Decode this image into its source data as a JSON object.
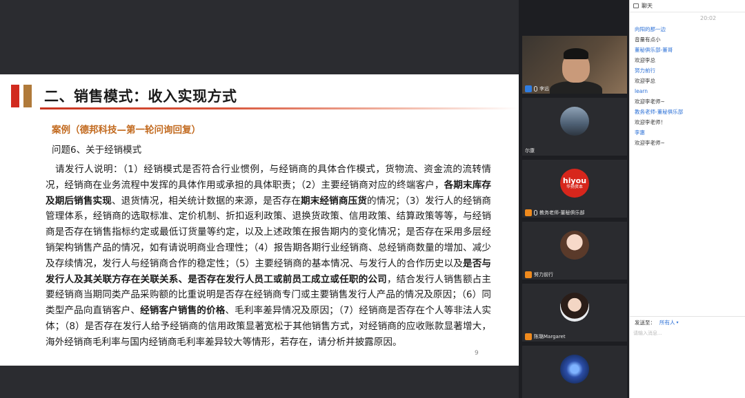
{
  "slide": {
    "title": "二、销售模式：收入实现方式",
    "case_title": "案例（德邦科技—第一轮问询回复）",
    "question": "问题6、关于经销模式",
    "body": [
      {
        "t": "请发行人说明：（1）经销模式是否符合行业惯例，与经销商的具体合作模式，货物流、资金流的流转情况，经销商在业务流程中发挥的具体作用或承担的具体职责；（2）主要经销商对应的终端客户，"
      },
      {
        "t": "各期末库存及期后销售实现",
        "b": true
      },
      {
        "t": "、退货情况，相关统计数据的来源，是否存在"
      },
      {
        "t": "期末经销商压货",
        "b": true
      },
      {
        "t": "的情况；（3）发行人的经销商管理体系，经销商的选取标准、定价机制、折扣返利政策、退换货政策、信用政策、结算政策等等，与经销商是否存在销售指标约定或最低订货量等约定，以及上述政策在报告期内的变化情况；是否存在采用多层经销架构销售产品的情况，如有请说明商业合理性；（4）报告期各期行业经销商、总经销商数量的增加、减少及存续情况，发行人与经销商合作的稳定性；（5）主要经销商的基本情况、与发行人的合作历史以及"
      },
      {
        "t": "是否与发行人及其关联方存在关联关系、是否存在发行人员工或前员工成立或任职的公司",
        "b": true
      },
      {
        "t": "，结合发行人销售额占主要经销商当期同类产品采购额的比重说明是否存在经销商专门或主要销售发行人产品的情况及原因；（6）同类型产品向直销客户、"
      },
      {
        "t": "经销客户销售的价格",
        "b": true
      },
      {
        "t": "、毛利率差异情况及原因；（7）经销商是否存在个人等非法人实体；（8）是否存在发行人给予经销商的信用政策显著宽松于其他销售方式，对经销商的应收账款显著增大，海外经销商毛利率与国内经销商毛利率差异较大等情形，若存在，请分析并披露原因。"
      }
    ],
    "page_number": "9",
    "colors": {
      "accent_red": "#d12b1f",
      "accent_brown": "#b07a3a",
      "case_orange": "#c26a1f"
    }
  },
  "videos": [
    {
      "name": "李远",
      "kind": "camera",
      "badge": "host-blue",
      "mic": true
    },
    {
      "name": "尔康",
      "kind": "avatar",
      "avatar": "city-icon"
    },
    {
      "name": "教务老师-董秘俱乐部",
      "kind": "avatar",
      "avatar": "hiyou-logo",
      "badge": "orange",
      "mic": true,
      "logo_text": "hiyou",
      "logo_sub": "华扬资本"
    },
    {
      "name": "努力前行",
      "kind": "avatar",
      "avatar": "cartoon-icon",
      "badge": "orange"
    },
    {
      "name": "陈璐Margaret",
      "kind": "avatar",
      "avatar": "woman-icon",
      "badge": "orange"
    },
    {
      "name": "",
      "kind": "avatar",
      "avatar": "space-icon"
    }
  ],
  "chat": {
    "title": "聊天",
    "time": "20:02",
    "messages": [
      {
        "type": "name",
        "text": "向阳的那一边"
      },
      {
        "type": "msg",
        "text": "音量有点小"
      },
      {
        "type": "name",
        "text": "董秘俱乐部-董哥"
      },
      {
        "type": "msg",
        "text": "欢迎李总"
      },
      {
        "type": "name",
        "text": "努力前行"
      },
      {
        "type": "msg",
        "text": "欢迎李总"
      },
      {
        "type": "name",
        "text": "learn"
      },
      {
        "type": "msg",
        "text": "欢迎李老师~"
      },
      {
        "type": "name",
        "text": "教务老师-董秘俱乐部"
      },
      {
        "type": "msg",
        "text": "欢迎李老师！"
      },
      {
        "type": "name",
        "text": "李惠"
      },
      {
        "type": "msg",
        "text": "欢迎李老师~"
      }
    ],
    "send_to_label": "发送至：",
    "send_to_value": "所有人",
    "input_placeholder": "请输入消息..."
  }
}
